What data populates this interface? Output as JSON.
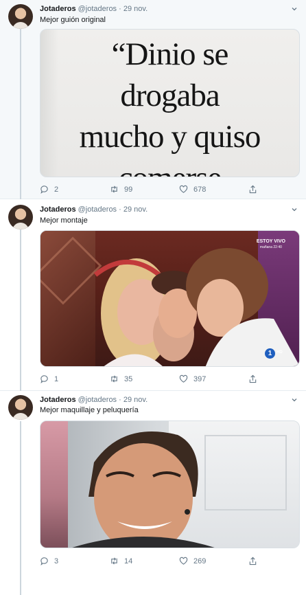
{
  "tweets": [
    {
      "name": "Jotaderos",
      "handle": "@jotaderos",
      "dot": "·",
      "date": "29 nov.",
      "text": "Mejor guión original",
      "media_quote": [
        "“Dinio se",
        "drogaba",
        "mucho y quiso",
        "comerse"
      ],
      "replies": "2",
      "retweets": "99",
      "likes": "678"
    },
    {
      "name": "Jotaderos",
      "handle": "@jotaderos",
      "dot": "·",
      "date": "29 nov.",
      "text": "Mejor montaje",
      "tv_badge": "ESTOY VIVO",
      "tv_badge_sub": "mañana 22:40",
      "tv_channel": "1",
      "tv_hd": "HD",
      "replies": "1",
      "retweets": "35",
      "likes": "397"
    },
    {
      "name": "Jotaderos",
      "handle": "@jotaderos",
      "dot": "·",
      "date": "29 nov.",
      "text": "Mejor maquillaje y peluquería",
      "replies": "3",
      "retweets": "14",
      "likes": "269"
    }
  ],
  "icons": {
    "reply": "reply-icon",
    "retweet": "retweet-icon",
    "like": "heart-icon",
    "share": "share-icon",
    "more": "chevron-down-icon"
  },
  "colors": {
    "text": "#14171a",
    "secondary": "#657786",
    "thread_line": "#ccd6dd",
    "highlight_bg": "#f5f8fa"
  }
}
